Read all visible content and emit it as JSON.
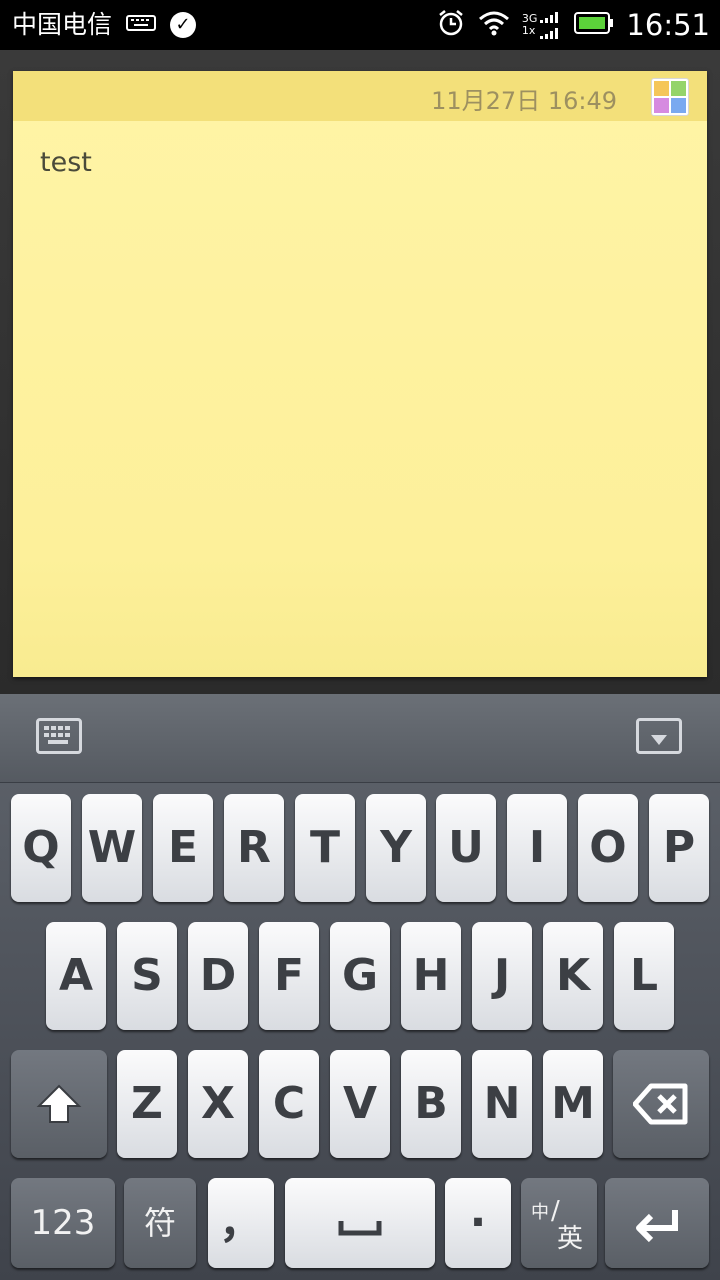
{
  "status_bar": {
    "carrier": "中国电信",
    "network_top": "3G",
    "network_bottom": "1x",
    "time": "16:51"
  },
  "note": {
    "date": "11月27日 16:49",
    "text": "test",
    "color_swatches": [
      "#f5c659",
      "#94d46a",
      "#d68ae0",
      "#7aa9f0"
    ]
  },
  "keyboard": {
    "row1": [
      "Q",
      "W",
      "E",
      "R",
      "T",
      "Y",
      "U",
      "I",
      "O",
      "P"
    ],
    "row2": [
      "A",
      "S",
      "D",
      "F",
      "G",
      "H",
      "J",
      "K",
      "L"
    ],
    "row3": [
      "Z",
      "X",
      "C",
      "V",
      "B",
      "N",
      "M"
    ],
    "numbers_label": "123",
    "symbols_label": "符",
    "comma_label": "，",
    "period_label": "·",
    "lang_top": "中",
    "lang_bottom": "英"
  }
}
